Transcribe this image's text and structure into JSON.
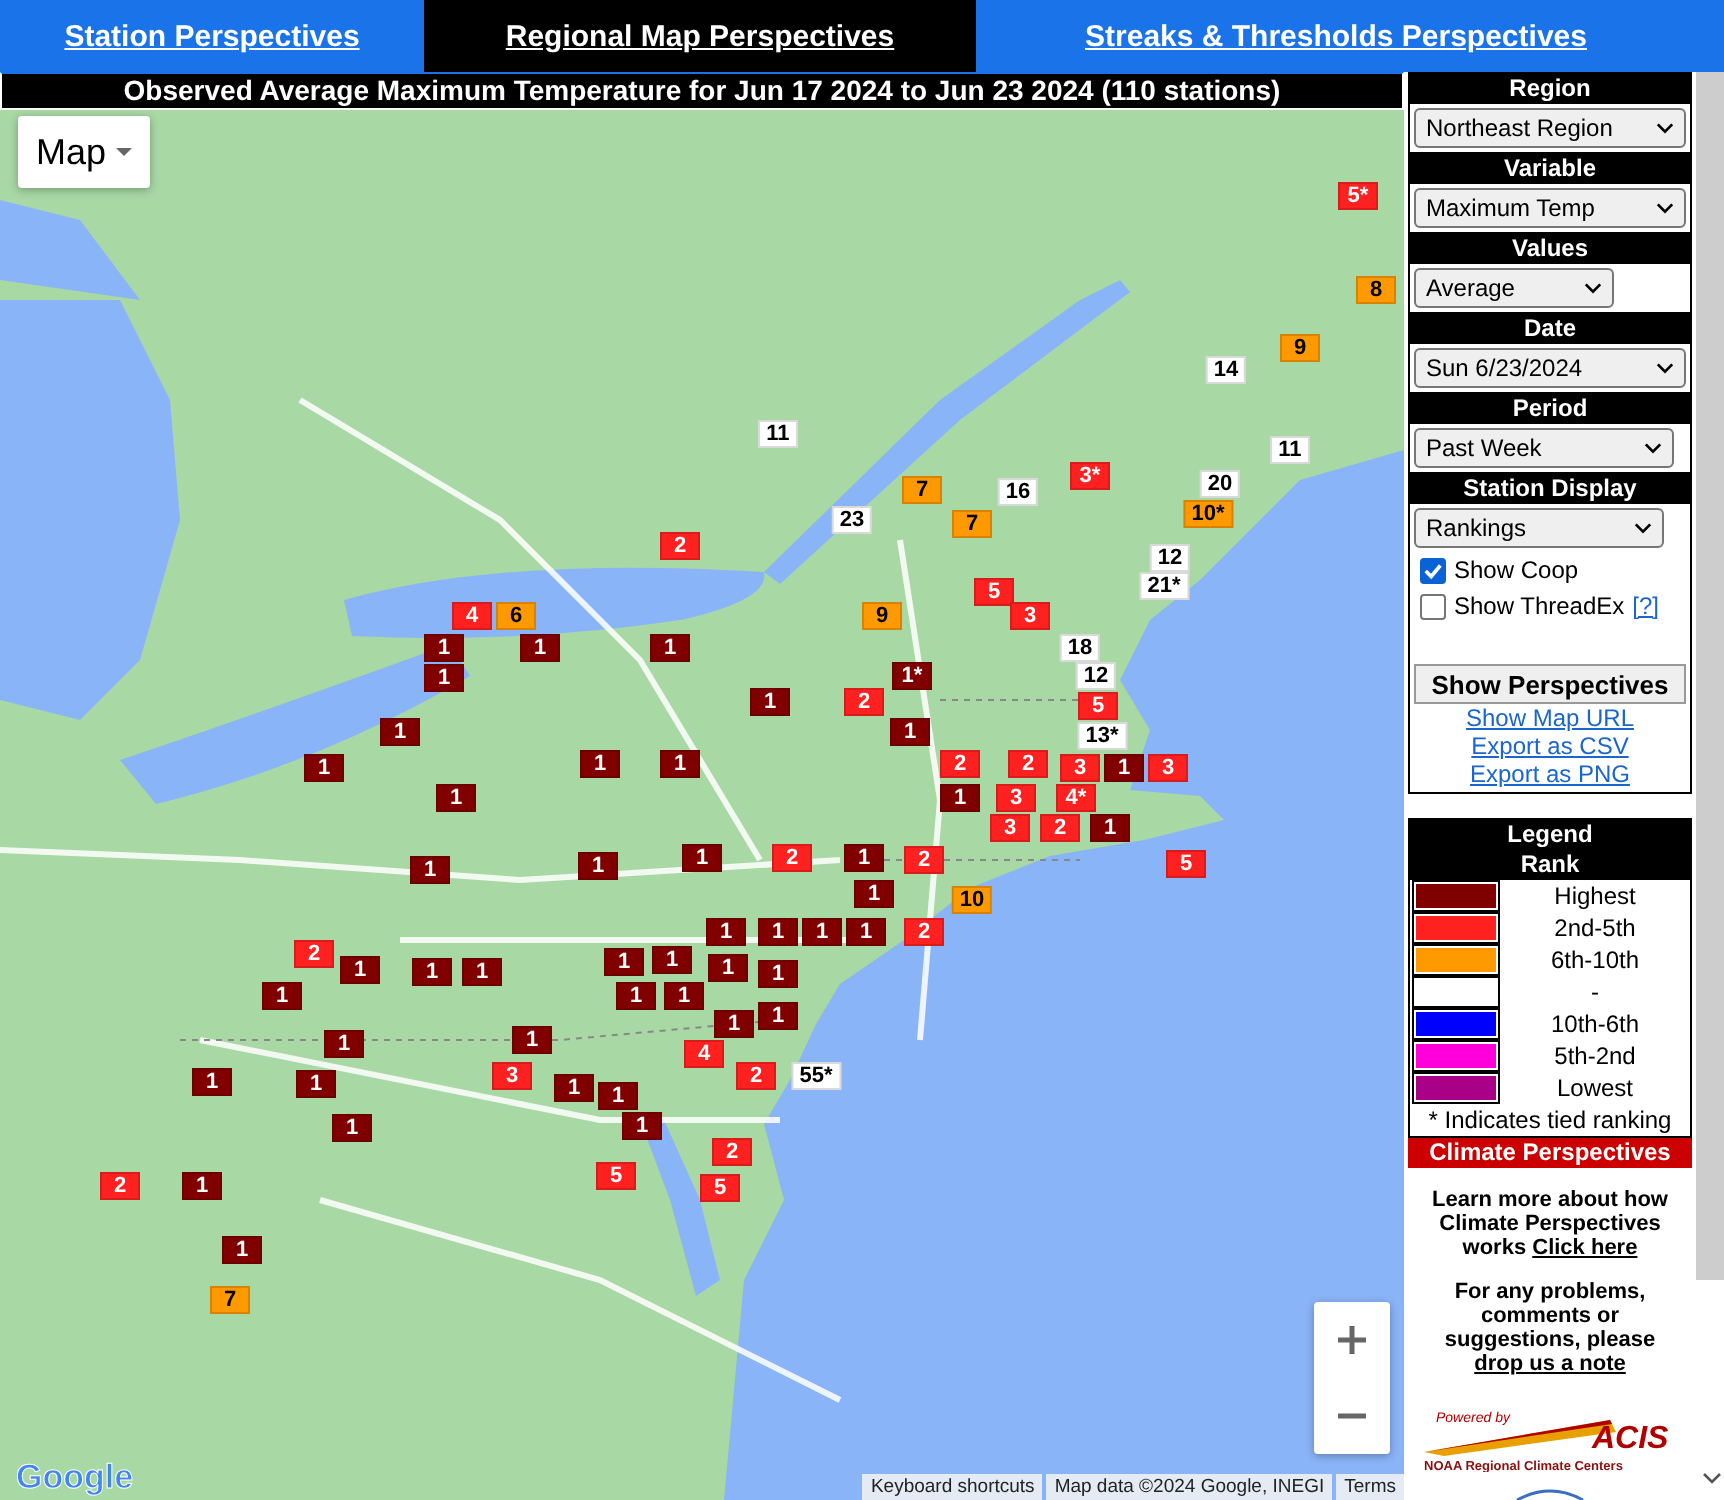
{
  "tabs": [
    {
      "label": "Station Perspectives",
      "selected": false
    },
    {
      "label": "Regional Map Perspectives",
      "selected": true
    },
    {
      "label": "Streaks & Thresholds Perspectives",
      "selected": false
    }
  ],
  "map": {
    "title": "Observed Average Maximum Temperature for Jun 17 2024 to Jun 23 2024 (110 stations)",
    "type_button": "Map",
    "logo": "Google",
    "attribution": [
      "Keyboard shortcuts",
      "Map data ©2024 Google, INEGI",
      "Terms"
    ],
    "markers": [
      {
        "label": "5*",
        "color": "#ff2020"
      },
      {
        "label": "8",
        "color": "#ff9900"
      },
      {
        "label": "14",
        "color": "#ffffff"
      },
      {
        "label": "9",
        "color": "#ff9900"
      },
      {
        "label": "11",
        "color": "#ffffff"
      },
      {
        "label": "11",
        "color": "#ffffff"
      },
      {
        "label": "7",
        "color": "#ff9900"
      },
      {
        "label": "16",
        "color": "#ffffff"
      },
      {
        "label": "3*",
        "color": "#ff2020"
      },
      {
        "label": "20",
        "color": "#ffffff"
      },
      {
        "label": "23",
        "color": "#ffffff"
      },
      {
        "label": "7",
        "color": "#ff9900"
      },
      {
        "label": "10*",
        "color": "#ff9900"
      },
      {
        "label": "2",
        "color": "#ff2020"
      },
      {
        "label": "12",
        "color": "#ffffff"
      },
      {
        "label": "5",
        "color": "#ff2020"
      },
      {
        "label": "21*",
        "color": "#ffffff"
      },
      {
        "label": "4",
        "color": "#ff2020"
      },
      {
        "label": "6",
        "color": "#ff9900"
      },
      {
        "label": "9",
        "color": "#ff9900"
      },
      {
        "label": "3",
        "color": "#ff2020"
      },
      {
        "label": "1",
        "color": "#800000"
      },
      {
        "label": "1",
        "color": "#800000"
      },
      {
        "label": "1",
        "color": "#800000"
      },
      {
        "label": "18",
        "color": "#ffffff"
      },
      {
        "label": "1",
        "color": "#800000"
      },
      {
        "label": "1*",
        "color": "#800000"
      },
      {
        "label": "12",
        "color": "#ffffff"
      },
      {
        "label": "1",
        "color": "#800000"
      },
      {
        "label": "2",
        "color": "#ff2020"
      },
      {
        "label": "5",
        "color": "#ff2020"
      },
      {
        "label": "1",
        "color": "#800000"
      },
      {
        "label": "1",
        "color": "#800000"
      },
      {
        "label": "13*",
        "color": "#ffffff"
      },
      {
        "label": "1",
        "color": "#800000"
      },
      {
        "label": "1",
        "color": "#800000"
      },
      {
        "label": "1",
        "color": "#800000"
      },
      {
        "label": "2",
        "color": "#ff2020"
      },
      {
        "label": "2",
        "color": "#ff2020"
      },
      {
        "label": "3",
        "color": "#ff2020"
      },
      {
        "label": "1",
        "color": "#800000"
      },
      {
        "label": "3",
        "color": "#ff2020"
      },
      {
        "label": "1",
        "color": "#800000"
      },
      {
        "label": "1",
        "color": "#800000"
      },
      {
        "label": "3",
        "color": "#ff2020"
      },
      {
        "label": "4*",
        "color": "#ff2020"
      },
      {
        "label": "3",
        "color": "#ff2020"
      },
      {
        "label": "2",
        "color": "#ff2020"
      },
      {
        "label": "1",
        "color": "#800000"
      },
      {
        "label": "1",
        "color": "#800000"
      },
      {
        "label": "1",
        "color": "#800000"
      },
      {
        "label": "1",
        "color": "#800000"
      },
      {
        "label": "2",
        "color": "#ff2020"
      },
      {
        "label": "1",
        "color": "#800000"
      },
      {
        "label": "2",
        "color": "#ff2020"
      },
      {
        "label": "5",
        "color": "#ff2020"
      },
      {
        "label": "1",
        "color": "#800000"
      },
      {
        "label": "10",
        "color": "#ff9900"
      },
      {
        "label": "1",
        "color": "#800000"
      },
      {
        "label": "1",
        "color": "#800000"
      },
      {
        "label": "1",
        "color": "#800000"
      },
      {
        "label": "1",
        "color": "#800000"
      },
      {
        "label": "2",
        "color": "#ff2020"
      },
      {
        "label": "2",
        "color": "#ff2020"
      },
      {
        "label": "1",
        "color": "#800000"
      },
      {
        "label": "1",
        "color": "#800000"
      },
      {
        "label": "1",
        "color": "#800000"
      },
      {
        "label": "1",
        "color": "#800000"
      },
      {
        "label": "1",
        "color": "#800000"
      },
      {
        "label": "1",
        "color": "#800000"
      },
      {
        "label": "1",
        "color": "#800000"
      },
      {
        "label": "1",
        "color": "#800000"
      },
      {
        "label": "1",
        "color": "#800000"
      },
      {
        "label": "1",
        "color": "#800000"
      },
      {
        "label": "1",
        "color": "#800000"
      },
      {
        "label": "1",
        "color": "#800000"
      },
      {
        "label": "1",
        "color": "#800000"
      },
      {
        "label": "1",
        "color": "#800000"
      },
      {
        "label": "4",
        "color": "#ff2020"
      },
      {
        "label": "1",
        "color": "#800000"
      },
      {
        "label": "1",
        "color": "#800000"
      },
      {
        "label": "3",
        "color": "#ff2020"
      },
      {
        "label": "1",
        "color": "#800000"
      },
      {
        "label": "1",
        "color": "#800000"
      },
      {
        "label": "2",
        "color": "#ff2020"
      },
      {
        "label": "55*",
        "color": "#ffffff"
      },
      {
        "label": "1",
        "color": "#800000"
      },
      {
        "label": "1",
        "color": "#800000"
      },
      {
        "label": "2",
        "color": "#ff2020"
      },
      {
        "label": "2",
        "color": "#ff2020"
      },
      {
        "label": "1",
        "color": "#800000"
      },
      {
        "label": "5",
        "color": "#ff2020"
      },
      {
        "label": "5",
        "color": "#ff2020"
      },
      {
        "label": "1",
        "color": "#800000"
      },
      {
        "label": "7",
        "color": "#ff9900"
      }
    ]
  },
  "sidebar": {
    "controls": [
      {
        "heading": "Region",
        "value": "Northeast Region"
      },
      {
        "heading": "Variable",
        "value": "Maximum Temp"
      },
      {
        "heading": "Values",
        "value": "Average"
      },
      {
        "heading": "Date",
        "value": "Sun 6/23/2024"
      },
      {
        "heading": "Period",
        "value": "Past Week"
      },
      {
        "heading": "Station Display",
        "value": "Rankings"
      }
    ],
    "checkboxes": [
      {
        "label": "Show Coop",
        "checked": true
      },
      {
        "label": "Show ThreadEx",
        "checked": false,
        "help": "[?]"
      }
    ],
    "button": "Show Perspectives",
    "links": [
      "Show Map URL",
      "Export as CSV",
      "Export as PNG"
    ],
    "legend": {
      "title": "Legend",
      "subtitle": "Rank",
      "items": [
        {
          "label": "Highest",
          "color": "#800000"
        },
        {
          "label": "2nd-5th",
          "color": "#ff2020"
        },
        {
          "label": "6th-10th",
          "color": "#ff9900"
        },
        {
          "label": "-",
          "color": "#ffffff"
        },
        {
          "label": "10th-6th",
          "color": "#0000ff"
        },
        {
          "label": "5th-2nd",
          "color": "#ff00dd"
        },
        {
          "label": "Lowest",
          "color": "#aa0088"
        }
      ],
      "note": "* Indicates tied ranking"
    },
    "banner": "Climate Perspectives",
    "info": [
      {
        "text": "Learn more about how Climate Perspectives works",
        "link": "Click here"
      },
      {
        "text": "For any problems, comments or suggestions, please",
        "link": "drop us a note"
      }
    ],
    "acis": {
      "powered": "Powered by",
      "name": "ACIS",
      "caption": "NOAA Regional Climate Centers"
    }
  }
}
